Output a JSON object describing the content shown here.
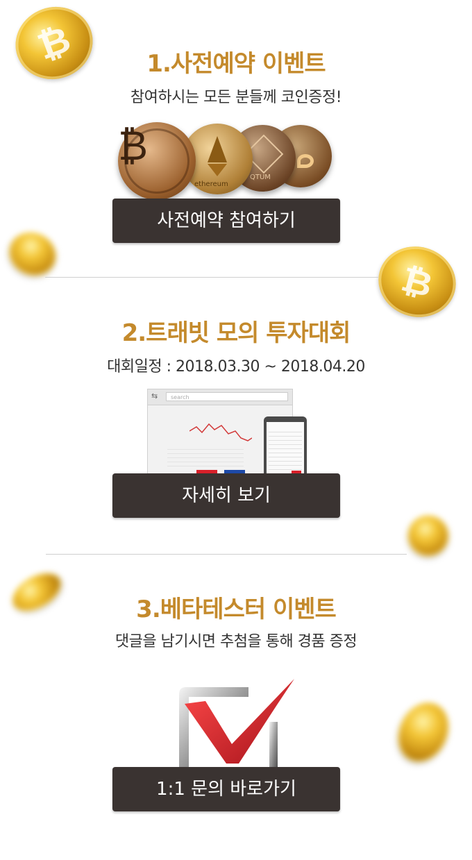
{
  "sections": [
    {
      "title": "1.사전예약 이벤트",
      "subtitle": "참여하시는 모든 분들께 코인증정!",
      "button": "사전예약 참여하기",
      "coin_text": [
        "ethereum",
        "QTUM"
      ]
    },
    {
      "title": "2.트래빗 모의 투자대회",
      "subtitle": "대회일정 : 2018.03.30 ~ 2018.04.20",
      "button": "자세히 보기",
      "search_placeholder": "search"
    },
    {
      "title": "3.베타테스터 이벤트",
      "subtitle": "댓글을 남기시면 추첨을 통해 경품 증정",
      "button": "1:1 문의 바로가기"
    }
  ],
  "icons": {
    "bitcoin": "₿"
  },
  "colors": {
    "title": "#c48a2c",
    "button_bg": "#3a3331",
    "gold": "#f3c536",
    "check_red": "#d8202a"
  }
}
